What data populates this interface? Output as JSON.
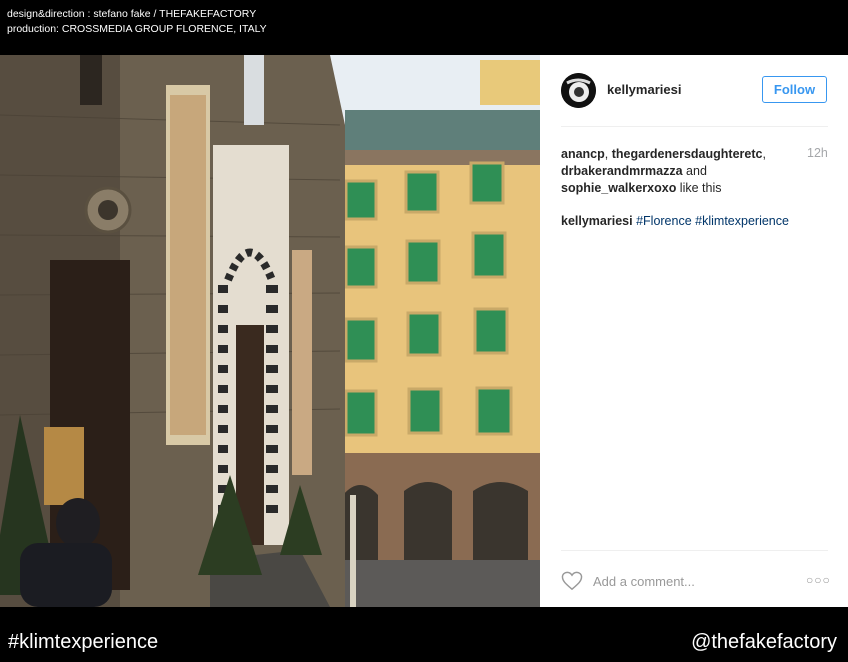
{
  "credits": {
    "line1": "design&direction : stefano fake / THEFAKEFACTORY",
    "line2": "production: CROSSMEDIA GROUP FLORENCE, ITALY"
  },
  "post": {
    "username": "kellymariesi",
    "follow_label": "Follow",
    "timestamp": "12h",
    "likes": {
      "users": [
        "anancp",
        "thegardenersdaughteretc",
        "drbakerandmrmazza",
        "sophie_walkerxoxo"
      ],
      "sep1": ", ",
      "sep2": ",",
      "and_text": " and",
      "suffix": " like this"
    },
    "caption": {
      "author": "kellymariesi",
      "tags": [
        "#Florence",
        "#klimtexperience"
      ]
    },
    "comment_placeholder": "Add a comment...",
    "more_icon": "ellipsis-icon",
    "like_icon": "heart-outline-icon"
  },
  "footer": {
    "hashtag": "#klimtexperience",
    "handle": "@thefakefactory"
  },
  "colors": {
    "background": "#000000",
    "follow_blue": "#3897f0",
    "hashtag_blue": "#003569"
  }
}
